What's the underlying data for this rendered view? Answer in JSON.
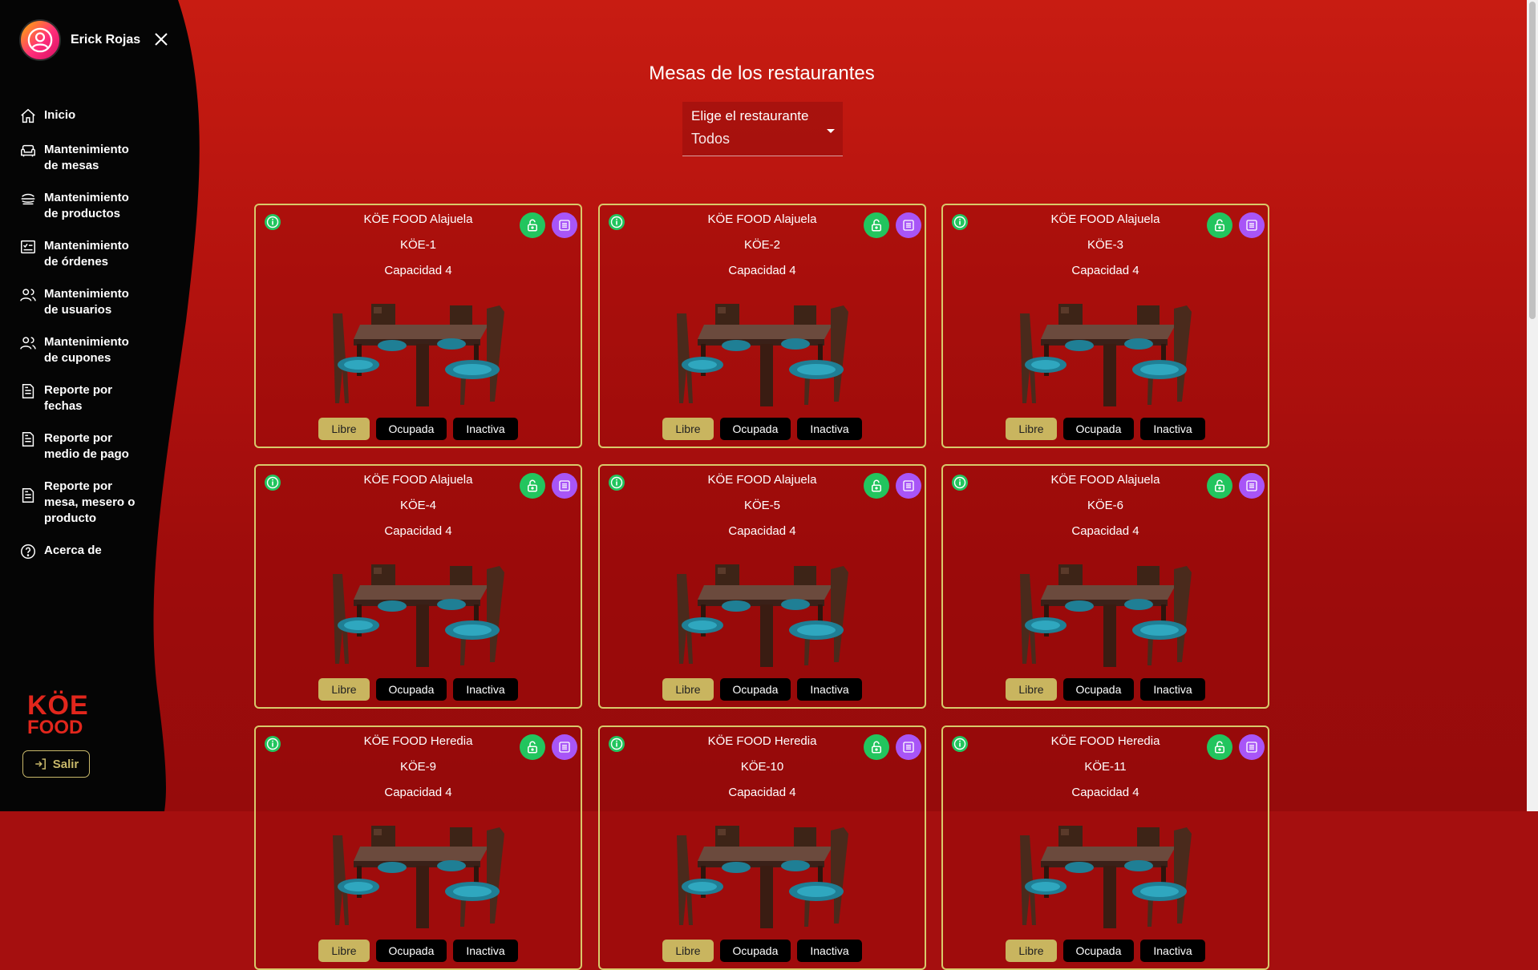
{
  "user": {
    "name": "Erick Rojas"
  },
  "nav": [
    {
      "label": "Inicio",
      "icon": "home-icon"
    },
    {
      "label": "Mantenimiento de mesas",
      "icon": "sofa-icon"
    },
    {
      "label": "Mantenimiento de productos",
      "icon": "food-icon"
    },
    {
      "label": "Mantenimiento de órdenes",
      "icon": "checklist-icon"
    },
    {
      "label": "Mantenimiento de usuarios",
      "icon": "users-icon"
    },
    {
      "label": "Mantenimiento de cupones",
      "icon": "users-icon"
    },
    {
      "label": "Reporte por fechas",
      "icon": "report-icon"
    },
    {
      "label": "Reporte por medio de pago",
      "icon": "report-icon"
    },
    {
      "label": "Reporte por mesa, mesero o producto",
      "icon": "report-icon"
    },
    {
      "label": "Acerca de",
      "icon": "help-icon"
    }
  ],
  "logo": {
    "line1": "KÖE",
    "line2": "FOOD"
  },
  "logout": {
    "label": "Salir"
  },
  "page": {
    "title": "Mesas de los restaurantes"
  },
  "filter": {
    "label": "Elige el restaurante",
    "value": "Todos"
  },
  "status_labels": {
    "free": "Libre",
    "busy": "Ocupada",
    "inactive": "Inactiva"
  },
  "tables": [
    {
      "restaurant": "KÖE FOOD Alajuela",
      "code": "KÖE-1",
      "capacity": "Capacidad 4",
      "status": "Libre"
    },
    {
      "restaurant": "KÖE FOOD Alajuela",
      "code": "KÖE-2",
      "capacity": "Capacidad 4",
      "status": "Libre"
    },
    {
      "restaurant": "KÖE FOOD Alajuela",
      "code": "KÖE-3",
      "capacity": "Capacidad 4",
      "status": "Libre"
    },
    {
      "restaurant": "KÖE FOOD Alajuela",
      "code": "KÖE-4",
      "capacity": "Capacidad 4",
      "status": "Libre"
    },
    {
      "restaurant": "KÖE FOOD Alajuela",
      "code": "KÖE-5",
      "capacity": "Capacidad 4",
      "status": "Libre"
    },
    {
      "restaurant": "KÖE FOOD Alajuela",
      "code": "KÖE-6",
      "capacity": "Capacidad 4",
      "status": "Libre"
    },
    {
      "restaurant": "KÖE FOOD Heredia",
      "code": "KÖE-9",
      "capacity": "Capacidad 4",
      "status": "Libre"
    },
    {
      "restaurant": "KÖE FOOD Heredia",
      "code": "KÖE-10",
      "capacity": "Capacidad 4",
      "status": "Libre"
    },
    {
      "restaurant": "KÖE FOOD Heredia",
      "code": "KÖE-11",
      "capacity": "Capacidad 4",
      "status": "Libre"
    }
  ],
  "colors": {
    "accent": "#c9b55f",
    "lock": "#22c55e",
    "list": "#a855f7",
    "brand": "#e2261c"
  }
}
